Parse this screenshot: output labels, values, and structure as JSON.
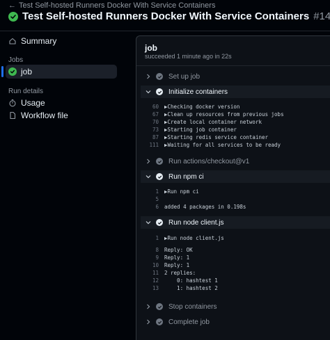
{
  "header": {
    "back_label": "Test Self-hosted Runners Docker With Service Containers",
    "title": "Test Self-hosted Runners Docker With Service Containers",
    "run_number": "#14"
  },
  "sidebar": {
    "summary": "Summary",
    "jobs_heading": "Jobs",
    "job_item": "job",
    "run_details_heading": "Run details",
    "usage": "Usage",
    "workflow_file": "Workflow file"
  },
  "job": {
    "name": "job",
    "status": "succeeded 1 minute ago in 22s"
  },
  "steps": [
    {
      "label": "Set up job",
      "expanded": false
    },
    {
      "label": "Initialize containers",
      "expanded": true,
      "lines": [
        {
          "n": "60",
          "text": "▶Checking docker version"
        },
        {
          "n": "67",
          "text": "▶Clean up resources from previous jobs"
        },
        {
          "n": "70",
          "text": "▶Create local container network"
        },
        {
          "n": "73",
          "text": "▶Starting job container"
        },
        {
          "n": "87",
          "text": "▶Starting redis service container"
        },
        {
          "n": "111",
          "text": "▶Waiting for all services to be ready"
        }
      ]
    },
    {
      "label": "Run actions/checkout@v1",
      "expanded": false
    },
    {
      "label": "Run npm ci",
      "expanded": true,
      "lines": [
        {
          "n": "1",
          "text": "▶Run npm ci"
        },
        {
          "n": "5",
          "text": ""
        },
        {
          "n": "6",
          "text": "added 4 packages in 0.198s"
        }
      ]
    },
    {
      "label": "Run node client.js",
      "expanded": true,
      "lines": [
        {
          "n": "1",
          "text": "▶Run node client.js"
        },
        {
          "n": "8",
          "text": "Reply: OK"
        },
        {
          "n": "9",
          "text": "Reply: 1"
        },
        {
          "n": "10",
          "text": "Reply: 1"
        },
        {
          "n": "11",
          "text": "2 replies:"
        },
        {
          "n": "12",
          "text": "    0: hashtest 1"
        },
        {
          "n": "13",
          "text": "    1: hashtest 2"
        }
      ]
    },
    {
      "label": "Stop containers",
      "expanded": false
    },
    {
      "label": "Complete job",
      "expanded": false
    }
  ],
  "colors": {
    "success": "#3fb950",
    "accent": "#1f6feb",
    "background": "#010409",
    "panel": "#0d1117"
  }
}
